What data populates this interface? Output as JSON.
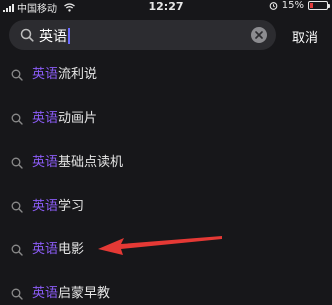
{
  "status_bar": {
    "carrier": "中国移动",
    "time": "12:27",
    "battery": "15%"
  },
  "search": {
    "query": "英语",
    "cancel_label": "取消"
  },
  "suggestions": [
    {
      "highlight": "英语",
      "rest": "流利说"
    },
    {
      "highlight": "英语",
      "rest": "动画片"
    },
    {
      "highlight": "英语",
      "rest": "基础点读机"
    },
    {
      "highlight": "英语",
      "rest": "学习"
    },
    {
      "highlight": "英语",
      "rest": "电影"
    },
    {
      "highlight": "英语",
      "rest": "启蒙早教"
    }
  ],
  "colors": {
    "background": "#17171a",
    "highlight": "#8b5cf6",
    "annotation_arrow": "#e53935"
  },
  "icons": [
    "signal-icon",
    "wifi-icon",
    "alarm-icon",
    "battery-icon",
    "search-icon",
    "clear-icon"
  ]
}
